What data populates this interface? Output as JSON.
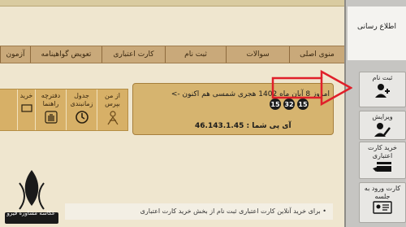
{
  "menu": [
    "منوی اصلی",
    "سوالات",
    "ثبت نام",
    "کارت اعتباری",
    "تعویض گواهینامه",
    "آزمون"
  ],
  "tiles": [
    {
      "label": "از من بپرس",
      "icon": "person-question-icon"
    },
    {
      "label": "جدول زمانبندی",
      "icon": "clock-icon"
    },
    {
      "label": "دفترچه راهنما",
      "icon": "hand-icon"
    },
    {
      "label": "خرید",
      "icon": "cart-icon"
    }
  ],
  "info": {
    "date_line": "امروز 8 آبان ماه 1402 هجری شمسی   هم اکنون ->",
    "clock": [
      "15",
      "32",
      "15"
    ],
    "ip_line": "آی پی شما : 46.143.1.45"
  },
  "notice": "برای خرید آنلاین کارت اعتباری ثبت نام از بخش خرید کارت اعتباری",
  "sidebar": {
    "header": "اطلاع رسانی",
    "items": [
      {
        "label": "ثبت نام",
        "icon": "user-add-icon"
      },
      {
        "label": "ویرایش",
        "icon": "user-edit-icon"
      },
      {
        "label": "خرید کارت اعتباری",
        "icon": "card-buy-icon"
      },
      {
        "label": "کارت ورود به جلسه",
        "icon": "entry-card-icon"
      }
    ]
  },
  "watermark": "عکاسه مشاوره فیروه"
}
